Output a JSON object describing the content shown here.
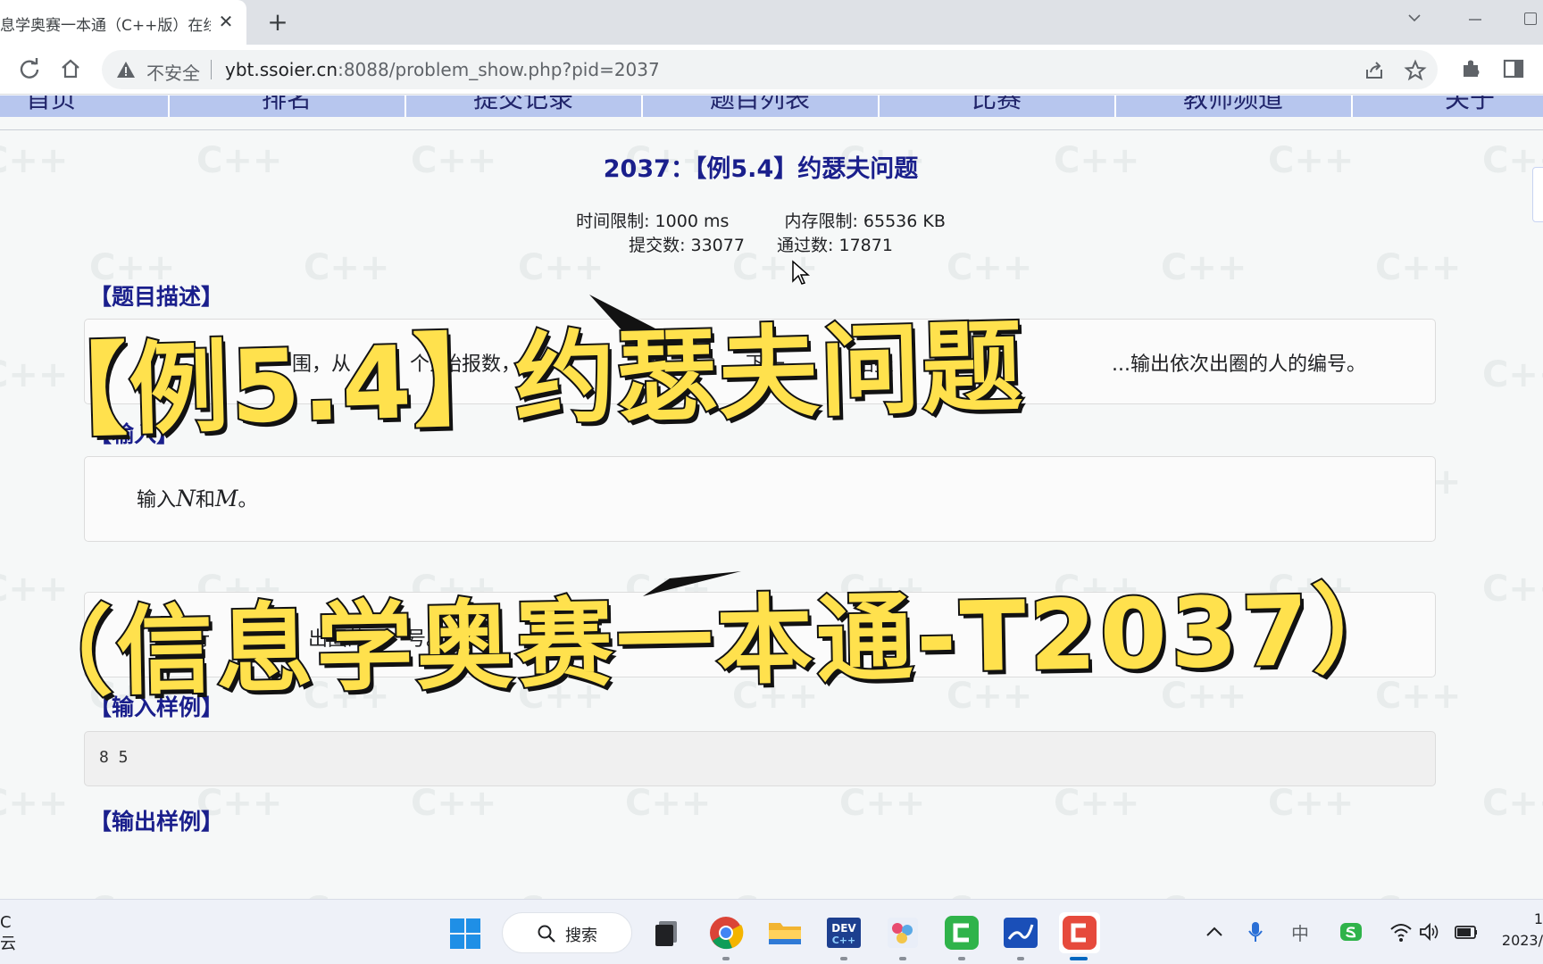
{
  "browser": {
    "tab_title": "息学奥赛一本通（C++版）在线",
    "tab_close": "✕",
    "new_tab": "+",
    "insecure_label": "不安全",
    "url_host": "ybt.ssoier.cn",
    "url_rest": ":8088/problem_show.php?pid=2037"
  },
  "nav": {
    "items": [
      "首页",
      "排名",
      "提交记录",
      "题目列表",
      "比赛",
      "教师频道",
      "关于"
    ]
  },
  "problem": {
    "title": "2037：【例5.4】约瑟夫问题",
    "time_limit": "时间限制: 1000 ms",
    "memory_limit": "内存限制: 65536 KB",
    "submissions": "提交数: 33077",
    "accepted": "通过数: 17871"
  },
  "sections": {
    "description_title": "【题目描述】",
    "description_fragments": [
      "围，从",
      "个人",
      "始报数，",
      "从",
      "下一",
      "始报",
      "...输出依次出圈的人的编号。"
    ],
    "input_title": "【输入】",
    "input_text_prefix": "输入",
    "input_var_n": "N",
    "input_text_mid": "和",
    "input_var_m": "M",
    "input_text_suffix": "。",
    "output_text_fragments": [
      "行",
      "出圈的",
      "号。"
    ],
    "sample_input_title": "【输入样例】",
    "sample_input": "8 5",
    "sample_output_title": "【输出样例】"
  },
  "banner": {
    "line1": "【例5.4】约瑟夫问题",
    "line2": "（信息学奥赛一本通-T2037）",
    "fill_color": "#ffe14d",
    "stroke_color": "#121212"
  },
  "watermark": {
    "text": "C++"
  },
  "taskbar": {
    "weather_line1": "C",
    "weather_line2": "云",
    "search_label": "搜索",
    "tray_lang": "中",
    "clock_line1": "1",
    "clock_line2": "2023/"
  },
  "colors": {
    "title_blue": "#1a1f8c",
    "nav_bar": "#b7c6ee"
  }
}
